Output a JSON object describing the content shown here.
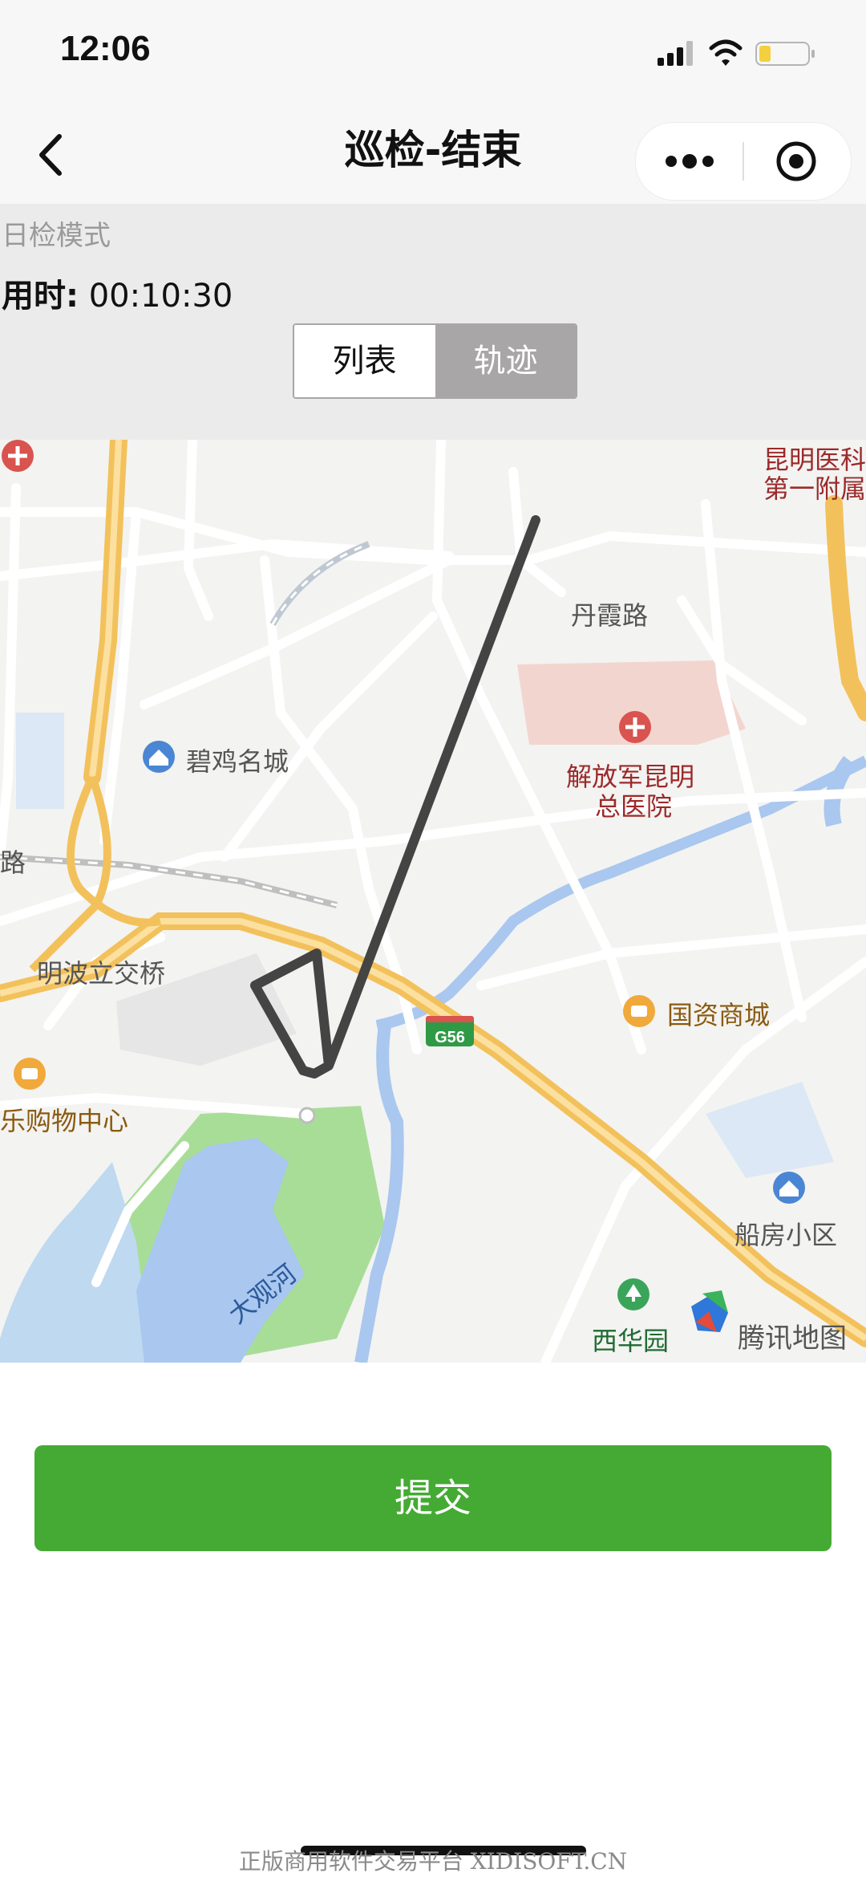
{
  "status_bar": {
    "time": "12:06",
    "icons": [
      "signal-icon",
      "wifi-icon",
      "battery-icon"
    ]
  },
  "nav": {
    "title": "巡检-结束",
    "back_icon": "chevron-left-icon",
    "more_icon": "more-dots-icon",
    "close_icon": "target-close-icon"
  },
  "info": {
    "mode": "日检模式",
    "time_label": "用时:",
    "time_value": "00:10:30"
  },
  "segment": {
    "tabs": [
      {
        "label": "列表",
        "active": false
      },
      {
        "label": "轨迹",
        "active": true
      }
    ]
  },
  "map": {
    "labels": {
      "hospital_top": "昆明医科",
      "hospital_top2": "第一附属",
      "road_danxia": "丹霞路",
      "bijimingcheng": "碧鸡名城",
      "hospital_main": "解放军昆明",
      "hospital_main2": "总医院",
      "mingbo_bridge": "明波立交桥",
      "guozi_mall": "国资商城",
      "shopping_center": "乐购物中心",
      "highway": "G56",
      "chuanfang": "船房小区",
      "daguanhe": "大观河",
      "xihuayuan": "西华园",
      "provider": "腾讯地图",
      "road_edge": "路"
    },
    "colors": {
      "track": "#444444",
      "highway": "#f3c15b",
      "water": "#a9c7ef",
      "park": "#a8dd98"
    }
  },
  "submit": {
    "label": "提交",
    "color": "#45aa33"
  },
  "watermark": "正版商用软件交易平台 XIDISOFT.CN"
}
